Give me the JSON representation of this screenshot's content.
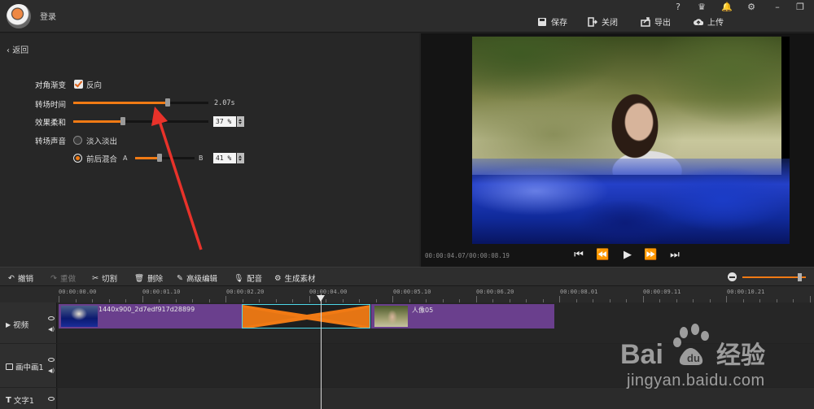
{
  "header": {
    "login": "登录",
    "buttons": {
      "save": "保存",
      "close": "关闭",
      "export": "导出",
      "upload": "上传"
    },
    "window_icons": [
      "help-icon",
      "crown-icon",
      "bell-icon",
      "gear-icon",
      "minimize-icon",
      "restore-icon"
    ]
  },
  "settings": {
    "back": "返回",
    "diagonal_gradient": {
      "label": "对角渐变",
      "option": "反向",
      "checked": true
    },
    "transition_time": {
      "label": "转场时间",
      "value_text": "2.07s",
      "fill_fraction": 0.7
    },
    "effect_softness": {
      "label": "效果柔和",
      "value_text": "37 %",
      "fill_fraction": 0.37
    },
    "transition_sound": {
      "label": "转场声音",
      "option_fade": "淡入淡出",
      "option_mix": "前后混合",
      "selected": "前后混合",
      "a_label": "A",
      "b_label": "B",
      "mix_value_text": "41 %",
      "mix_fraction": 0.41
    }
  },
  "preview": {
    "timecode": "00:00:04.07/00:00:08.19"
  },
  "toolbar": {
    "undo": "撤销",
    "redo": "重做",
    "cut": "切割",
    "delete": "删除",
    "advanced_edit": "高级编辑",
    "dub": "配音",
    "generate": "生成素材"
  },
  "timeline": {
    "ruler_labels": [
      "00:00:00.00",
      "00:00:01.10",
      "00:00:02.20",
      "00:00:04.00",
      "00:00:05.10",
      "00:00:06.20",
      "00:00:08.01",
      "00:00:09.11",
      "00:00:10.21"
    ],
    "tracks": {
      "video": "视频",
      "pip": "画中画1",
      "text": "文字1"
    },
    "clips": [
      {
        "name": "1440x900_2d7edf917d28899"
      },
      {
        "name": "人像05"
      }
    ]
  },
  "watermark": {
    "text": "jingyan.baidu.com",
    "logo": "Bai du 经验"
  }
}
